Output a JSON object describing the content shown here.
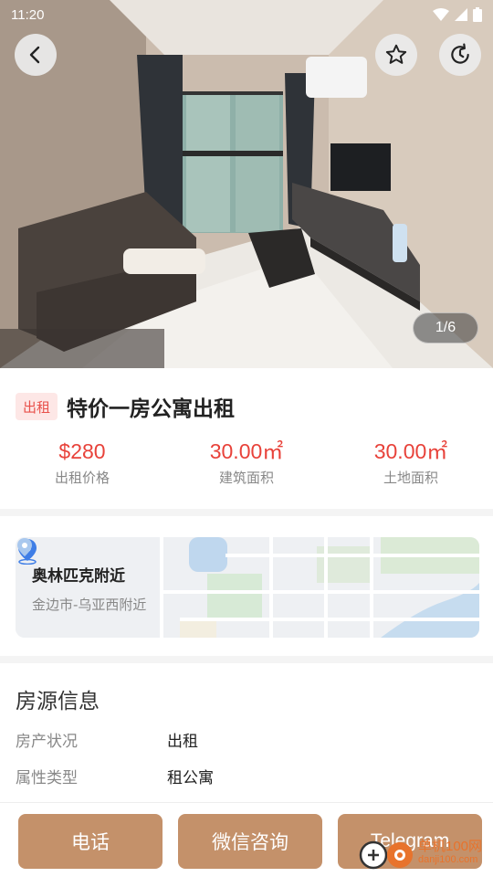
{
  "status_bar": {
    "time": "11:20"
  },
  "gallery": {
    "counter": "1/6"
  },
  "listing": {
    "tag": "出租",
    "title": "特价一房公寓出租",
    "stats": [
      {
        "value": "$280",
        "label": "出租价格"
      },
      {
        "value": "30.00㎡",
        "label": "建筑面积"
      },
      {
        "value": "30.00㎡",
        "label": "土地面积"
      }
    ]
  },
  "location": {
    "name": "奥林匹克附近",
    "address": "金边市-乌亚西附近"
  },
  "property_info": {
    "heading": "房源信息",
    "rows": [
      {
        "key": "房产状况",
        "value": "出租"
      },
      {
        "key": "属性类型",
        "value": "租公寓"
      }
    ]
  },
  "actions": {
    "phone": "电话",
    "wechat": "微信咨询",
    "telegram": "Telegram"
  },
  "watermark": {
    "line1": "单机100网",
    "line2": "danji100.com"
  },
  "colors": {
    "accent_red": "#e8423a",
    "button_brown": "#c4916a",
    "tag_bg": "#fde7e6"
  }
}
